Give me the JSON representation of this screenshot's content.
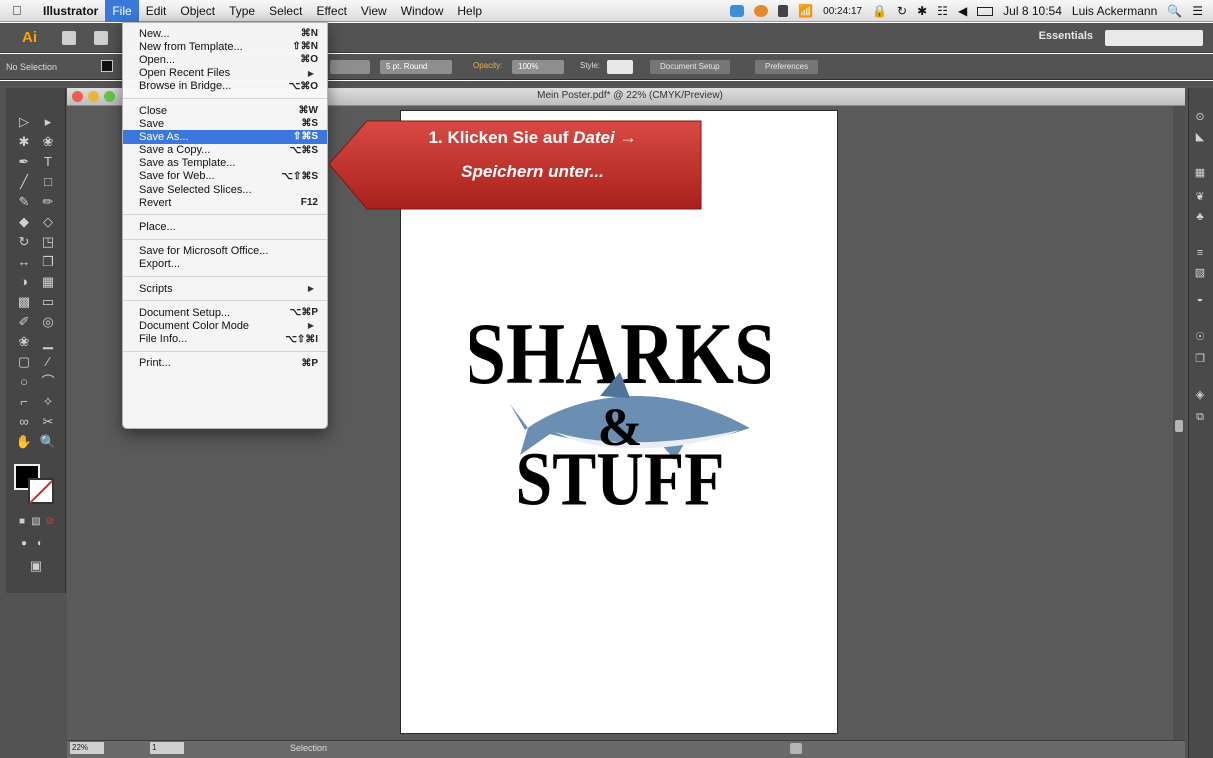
{
  "menubar": {
    "app_name": "Illustrator",
    "items": [
      "File",
      "Edit",
      "Object",
      "Type",
      "Select",
      "Effect",
      "View",
      "Window",
      "Help"
    ],
    "active_item": "File",
    "clock_timer": "00:24:17",
    "date_time": "Jul 8  10:54",
    "user": "Luis Ackermann"
  },
  "appbar": {
    "logo": "Ai",
    "workspace": "Essentials"
  },
  "controlbar": {
    "no_selection": "No Selection",
    "stroke_profile": "5 pt. Round",
    "opacity_label": "Opacity:",
    "opacity_value": "100%",
    "style_label": "Style:",
    "document_setup": "Document Setup",
    "preferences": "Preferences"
  },
  "document": {
    "title": "Mein Poster.pdf* @ 22% (CMYK/Preview)",
    "art_line1": "SHARKS",
    "art_amp": "&",
    "art_line2": "STUFF"
  },
  "statusbar": {
    "zoom": "22%",
    "page": "1",
    "tool": "Selection"
  },
  "file_menu": {
    "items": [
      {
        "label": "New...",
        "shortcut": "⌘N"
      },
      {
        "label": "New from Template...",
        "shortcut": "⇧⌘N"
      },
      {
        "label": "Open...",
        "shortcut": "⌘O"
      },
      {
        "label": "Open Recent Files",
        "submenu": "▶"
      },
      {
        "label": "Browse in Bridge...",
        "shortcut": "⌥⌘O"
      },
      {
        "label": "Close",
        "shortcut": "⌘W"
      },
      {
        "label": "Save",
        "shortcut": "⌘S"
      },
      {
        "label": "Save As...",
        "shortcut": "⇧⌘S"
      },
      {
        "label": "Save a Copy...",
        "shortcut": "⌥⌘S"
      },
      {
        "label": "Save as Template..."
      },
      {
        "label": "Save for Web...",
        "shortcut": "⌥⇧⌘S"
      },
      {
        "label": "Save Selected Slices..."
      },
      {
        "label": "Revert",
        "shortcut": "F12"
      },
      {
        "label": "Place..."
      },
      {
        "label": "Save for Microsoft Office..."
      },
      {
        "label": "Export..."
      },
      {
        "label": "Scripts",
        "submenu": "▶"
      },
      {
        "label": "Document Setup...",
        "shortcut": "⌥⌘P"
      },
      {
        "label": "Document Color Mode",
        "submenu": "▶"
      },
      {
        "label": "File Info...",
        "shortcut": "⌥⇧⌘I"
      },
      {
        "label": "Print...",
        "shortcut": "⌘P"
      }
    ],
    "selected": "Save As..."
  },
  "callout": {
    "line1_prefix": "1. Klicken Sie auf ",
    "line1_italic": "Datei",
    "arrow": "→",
    "line2": "Speichern unter...",
    "color": "#c0302b"
  }
}
